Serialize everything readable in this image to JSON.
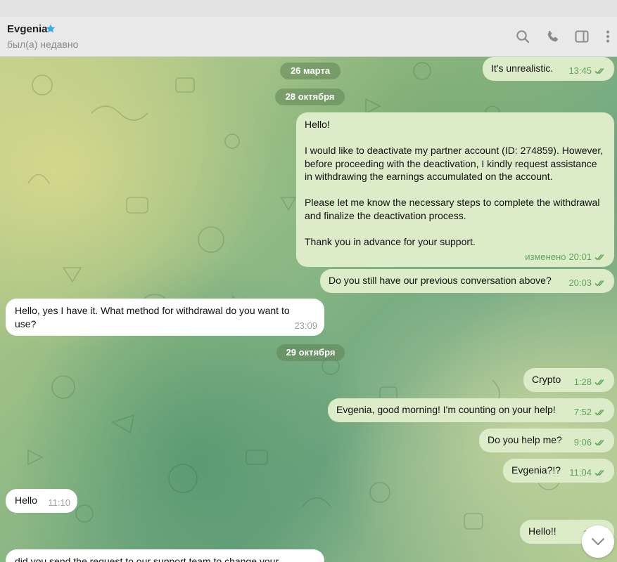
{
  "header": {
    "contact_name": "Evgenia",
    "status": "был(а) недавно",
    "icons": [
      "star-icon",
      "search-icon",
      "phone-icon",
      "sidebar-toggle-icon",
      "more-vertical-icon"
    ]
  },
  "date_separators": [
    "26 марта",
    "28 октября",
    "29 октября"
  ],
  "messages": [
    {
      "direction": "outgoing",
      "text": "It's unrealistic.",
      "time": "13:45",
      "edited": ""
    },
    {
      "direction": "outgoing",
      "text": "Hello!\n\nI would like to deactivate my partner account (ID: 274859). However, before proceeding with the deactivation, I kindly request assistance in withdrawing the earnings accumulated on the account.\n\nPlease let me know the necessary steps to complete the withdrawal and finalize the deactivation process.\n\nThank you in advance for your support.",
      "time": "20:01",
      "edited": "изменено"
    },
    {
      "direction": "outgoing",
      "text": "Do you still have our previous conversation above?",
      "time": "20:03",
      "edited": ""
    },
    {
      "direction": "incoming",
      "text": "Hello, yes I have it. What method for withdrawal do you want to use?",
      "time": "23:09",
      "edited": ""
    },
    {
      "direction": "outgoing",
      "text": "Crypto",
      "time": "1:28",
      "edited": ""
    },
    {
      "direction": "outgoing",
      "text": "Evgenia, good morning! I'm counting on your help!",
      "time": "7:52",
      "edited": ""
    },
    {
      "direction": "outgoing",
      "text": "Do you help me?",
      "time": "9:06",
      "edited": ""
    },
    {
      "direction": "outgoing",
      "text": "Evgenia?!?",
      "time": "11:04",
      "edited": ""
    },
    {
      "direction": "incoming",
      "text": "Hello",
      "time": "11:10",
      "edited": ""
    },
    {
      "direction": "outgoing",
      "text": "Hello!!",
      "time": "11:1",
      "edited": ""
    },
    {
      "direction": "incoming",
      "text": "did you send the request to our support team to change your",
      "time": "",
      "edited": ""
    }
  ],
  "colors": {
    "outgoing_bubble": "#dcebc8",
    "incoming_bubble": "#ffffff",
    "read_ticks": "#5fa65a",
    "star": "#3da8e8"
  }
}
